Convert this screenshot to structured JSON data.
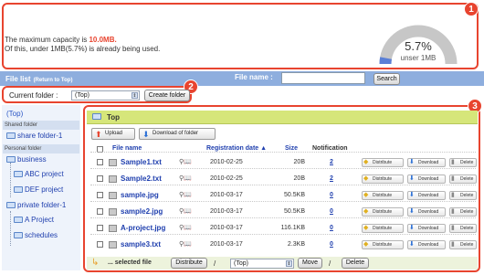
{
  "capacity": {
    "line1_prefix": "The maximum capacity is ",
    "max": "10.0MB.",
    "line2": "Of this, under 1MB(5.7%) is already being used.",
    "percent": "5.7%",
    "gauge_sub": "unser 1MB",
    "usage_fraction": 0.057
  },
  "callouts": [
    "1",
    "2",
    "3"
  ],
  "header_bar": {
    "file_list": "File list",
    "return_top": "(Return to Top)",
    "file_name_label": "File name :",
    "file_name_value": "",
    "search_button": "Search"
  },
  "current_folder": {
    "label": "Current folder :",
    "selected": "(Top)",
    "create_button": "Create folder"
  },
  "tree": {
    "root": "(Top)",
    "shared_label": "Shared folder",
    "shared_items": [
      "share folder-1"
    ],
    "personal_label": "Personal folder",
    "personal_items": [
      "business",
      "ABC project",
      "DEF project",
      "private folder-1",
      "A Project",
      "schedules"
    ]
  },
  "main": {
    "title": "Top",
    "upload_button": "Upload",
    "download_folder_button": "Download of folder",
    "columns": {
      "file_name": "File name",
      "registration_date": "Registration date",
      "sort_indicator": "▲",
      "size": "Size",
      "notification": "Notification"
    },
    "rows": [
      {
        "name": "Sample1.txt",
        "date": "2010-02-25",
        "size": "20B",
        "notify": "2"
      },
      {
        "name": "Sample2.txt",
        "date": "2010-02-25",
        "size": "20B",
        "notify": "2"
      },
      {
        "name": "sample.jpg",
        "date": "2010-03-17",
        "size": "50.5KB",
        "notify": "0"
      },
      {
        "name": "sample2.jpg",
        "date": "2010-03-17",
        "size": "50.5KB",
        "notify": "0"
      },
      {
        "name": "A-project.jpg",
        "date": "2010-03-17",
        "size": "116.1KB",
        "notify": "0"
      },
      {
        "name": "sample3.txt",
        "date": "2010-03-17",
        "size": "2.3KB",
        "notify": "0"
      }
    ],
    "actions": {
      "distribute": "Distribute",
      "download": "Download",
      "delete": "Delete"
    },
    "bottom": {
      "selected_label": "... selected file",
      "distribute_button": "Distribute",
      "slash": "/",
      "folder_select": "(Top)",
      "move_button": "Move",
      "delete_button": "Delete"
    }
  },
  "colors": {
    "accent": "#e8442f",
    "header_bar": "#8eaede",
    "folder_header": "#d6e67a",
    "link": "#1f3fae"
  }
}
